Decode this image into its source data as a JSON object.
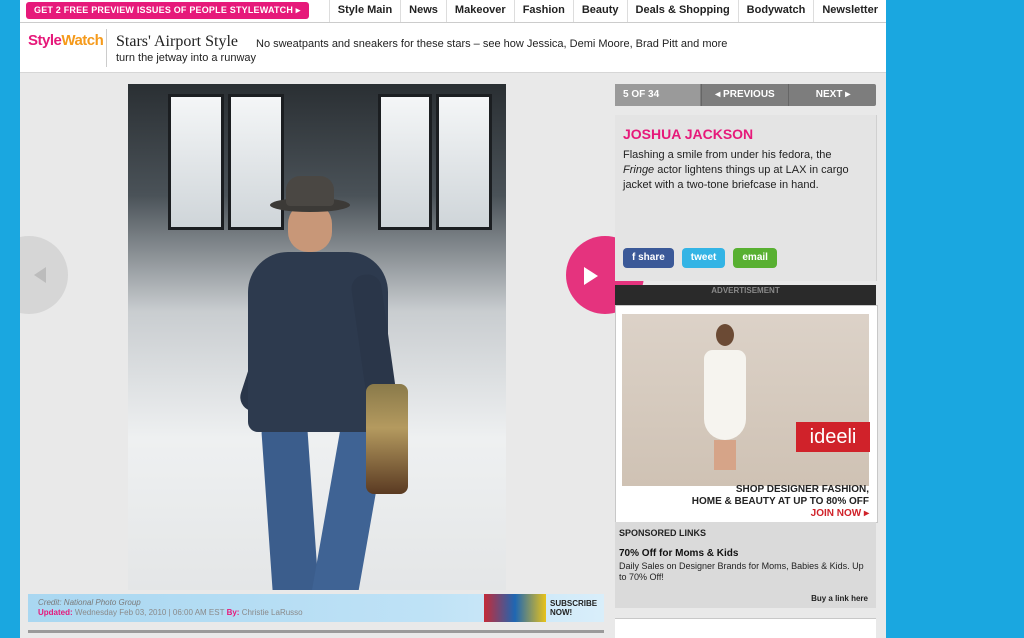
{
  "header": {
    "promo_label": "GET 2 FREE PREVIEW ISSUES OF PEOPLE STYLEWATCH ▸",
    "nav": [
      "Style Main",
      "News",
      "Makeover",
      "Fashion",
      "Beauty",
      "Deals & Shopping",
      "Bodywatch",
      "Newsletter"
    ]
  },
  "titlebar": {
    "logo_part1": "Style",
    "logo_part2": "Watch",
    "title": "Stars' Airport Style",
    "description": "No sweatpants and sneakers for these stars – see how Jessica, Demi Moore, Brad Pitt and more turn the jetway into a runway"
  },
  "gallery": {
    "counter": "5 OF 34",
    "prev_label": "◂ PREVIOUS",
    "next_label": "NEXT ▸",
    "celebrity": "JOSHUA JACKSON",
    "caption_pre": "Flashing a smile from under his fedora, the ",
    "caption_em": "Fringe",
    "caption_post": " actor lightens things up at LAX in cargo jacket with a two-tone briefcase in hand.",
    "share": {
      "facebook": "f share",
      "twitter": "tweet",
      "email": "email"
    },
    "credit": "Credit: National Photo Group",
    "updated_label": "Updated:",
    "updated_date": "Wednesday Feb 03, 2010 | 06:00 AM EST",
    "by_label": "By:",
    "author": "Christie LaRusso",
    "subscribe_line1": "SUBSCRIBE",
    "subscribe_line2": "NOW!"
  },
  "ad": {
    "header": "ADVERTISEMENT",
    "brand": "ideeli",
    "line1": "SHOP DESIGNER FASHION,",
    "line2": "HOME & BEAUTY AT UP TO 80% OFF",
    "line3": "JOIN NOW ▸"
  },
  "sponsored": {
    "heading": "SPONSORED LINKS",
    "title": "70% Off for Moms & Kids",
    "body": "Daily Sales on Designer Brands for Moms, Babies & Kids. Up to 70% Off!",
    "buy_link": "Buy a link here"
  },
  "colors": {
    "brand_pink": "#e6197a",
    "page_bg": "#1aa7e0"
  }
}
